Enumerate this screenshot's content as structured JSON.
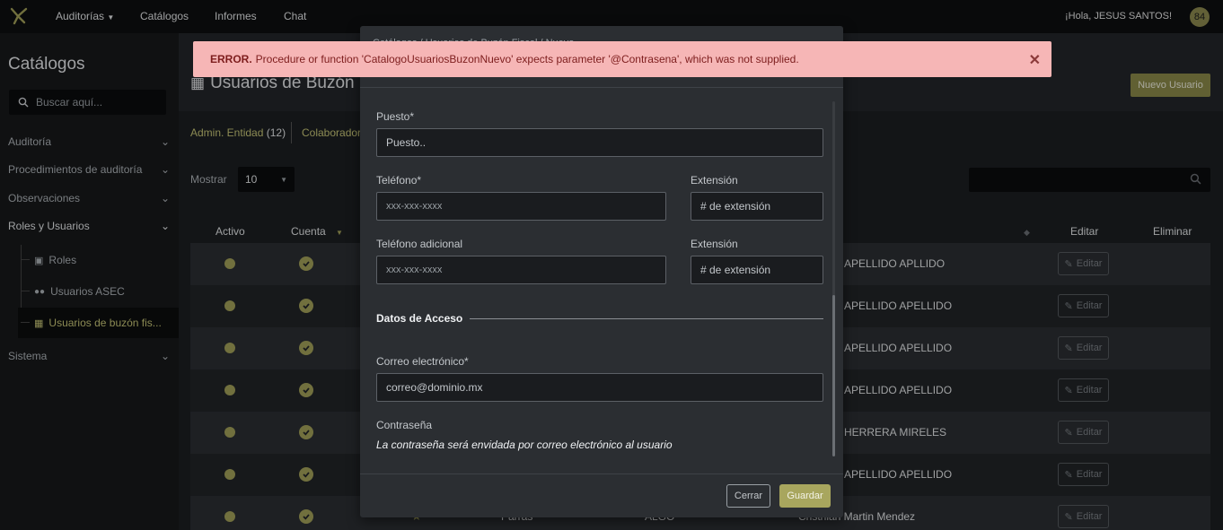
{
  "topbar": {
    "nav": [
      "Auditorías",
      "Catálogos",
      "Informes",
      "Chat"
    ],
    "greeting": "¡Hola, JESUS SANTOS!",
    "avatar": "84"
  },
  "sidebar": {
    "title": "Catálogos",
    "search_placeholder": "Buscar aquí...",
    "items": [
      "Auditoría",
      "Procedimientos de auditoría",
      "Observaciones",
      "Roles y Usuarios",
      "Sistema"
    ],
    "subitems": [
      "Roles",
      "Usuarios ASEC",
      "Usuarios de buzón fis..."
    ]
  },
  "main": {
    "page_title": "Usuarios de Buzón F",
    "new_user_button": "Nuevo Usuario",
    "tabs": [
      {
        "label": "Admin. Entidad",
        "count": "(12)"
      },
      {
        "label": "Colaborador"
      }
    ],
    "show_label": "Mostrar",
    "show_value": "10",
    "headers": [
      "Activo",
      "Cuenta",
      "Editar",
      "Eliminar"
    ],
    "rows": [
      {
        "name": "APELLIDO APLLIDO",
        "edit": "Editar"
      },
      {
        "name": "APELLIDO APELLIDO",
        "edit": "Editar"
      },
      {
        "name": "APELLIDO APELLIDO",
        "edit": "Editar"
      },
      {
        "name": "APELLIDO APELLIDO",
        "edit": "Editar"
      },
      {
        "name": "HERRERA MIRELES",
        "edit": "Editar"
      },
      {
        "name": "APELLIDO APELLIDO",
        "edit": "Editar"
      },
      {
        "name": "Cristhian Martin Mendez",
        "edit": "Editar",
        "col3": "Parras",
        "col4": "ALGO"
      }
    ]
  },
  "alert": {
    "prefix": "ERROR.",
    "message": "Procedure or function 'CatalogoUsuariosBuzonNuevo' expects parameter '@Contrasena', which was not supplied."
  },
  "modal": {
    "header_hint": "Catálogos / Usuarios de Buzón Fiscal / Nuevo",
    "puesto_label": "Puesto*",
    "puesto_value": "Puesto..",
    "telefono_label": "Teléfono*",
    "telefono_placeholder": "xxx-xxx-xxxx",
    "extension_label": "Extensión",
    "extension_placeholder": "# de extensión",
    "telefono_adicional_label": "Teléfono adicional",
    "telefono_adicional_placeholder": "xxx-xxx-xxxx",
    "extension2_label": "Extensión",
    "extension2_placeholder": "# de extensión",
    "section_title": "Datos de Acceso",
    "correo_label": "Correo electrónico*",
    "correo_value": "correo@dominio.mx",
    "contrasena_label": "Contraseña",
    "contrasena_note": "La contraseña será envidada por correo electrónico al usuario",
    "close_button": "Cerrar",
    "save_button": "Guardar"
  },
  "colors": {
    "accent": "#a8a65e",
    "alert_bg": "#f6b6b6",
    "alert_text": "#7d1d1d"
  }
}
